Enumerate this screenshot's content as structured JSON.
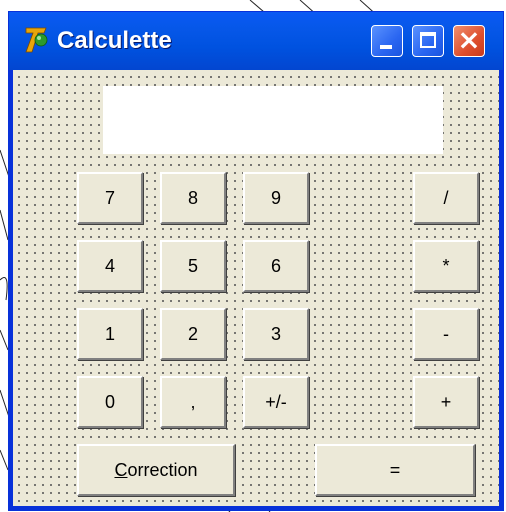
{
  "window": {
    "title": "Calculette",
    "controls": {
      "minimize": "minimize",
      "maximize": "maximize",
      "close": "close"
    }
  },
  "display": {
    "value": ""
  },
  "keys": {
    "k7": "7",
    "k8": "8",
    "k9": "9",
    "div": "/",
    "k4": "4",
    "k5": "5",
    "k6": "6",
    "mul": "*",
    "k1": "1",
    "k2": "2",
    "k3": "3",
    "sub": "-",
    "k0": "0",
    "comma": ",",
    "sign": "+/-",
    "add": "+",
    "correction_first": "C",
    "correction_rest": "orrection",
    "equals": "="
  },
  "colors": {
    "titlebar": "#0052e0",
    "client_bg": "#ece9d8",
    "close_button": "#de4f2e"
  },
  "icons": [
    "app-icon",
    "minimize-icon",
    "maximize-icon",
    "close-icon"
  ]
}
